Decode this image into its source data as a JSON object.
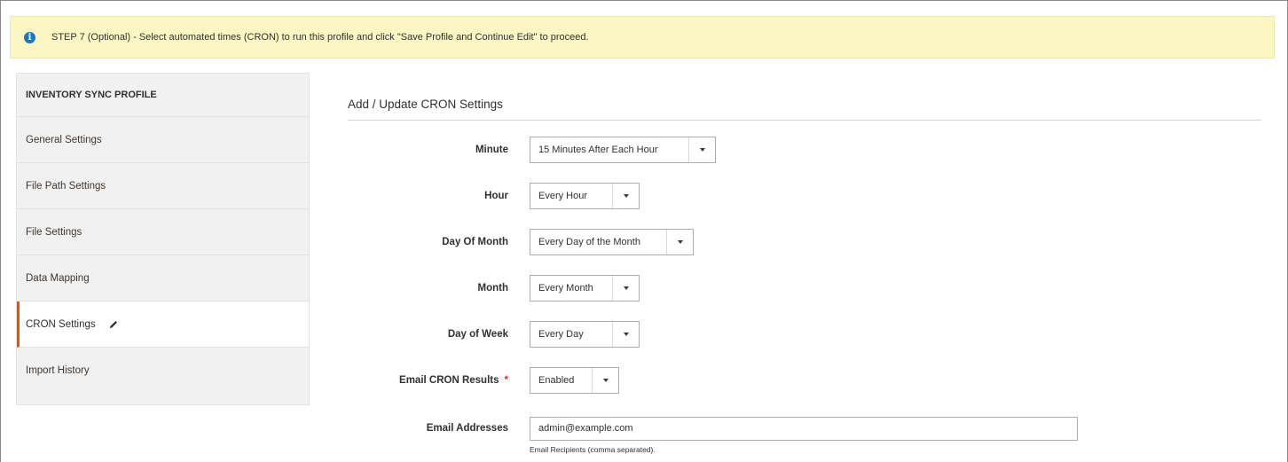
{
  "notice": {
    "icon": "info-icon",
    "text": "STEP 7 (Optional) - Select automated times (CRON) to run this profile and click \"Save Profile and Continue Edit\" to proceed."
  },
  "sidebar": {
    "title": "INVENTORY SYNC PROFILE",
    "items": [
      {
        "label": "General Settings",
        "active": false
      },
      {
        "label": "File Path Settings",
        "active": false
      },
      {
        "label": "File Settings",
        "active": false
      },
      {
        "label": "Data Mapping",
        "active": false
      },
      {
        "label": "CRON Settings",
        "active": true,
        "icon": "pencil-icon"
      },
      {
        "label": "Import History",
        "active": false
      }
    ]
  },
  "section": {
    "title": "Add / Update CRON Settings"
  },
  "form": {
    "minute": {
      "label": "Minute",
      "value": "15 Minutes After Each Hour"
    },
    "hour": {
      "label": "Hour",
      "value": "Every Hour"
    },
    "day_of_month": {
      "label": "Day Of Month",
      "value": "Every Day of the Month"
    },
    "month": {
      "label": "Month",
      "value": "Every Month"
    },
    "day_of_week": {
      "label": "Day of Week",
      "value": "Every Day"
    },
    "email_results": {
      "label": "Email CRON Results",
      "required_mark": "*",
      "value": "Enabled"
    },
    "email_addresses": {
      "label": "Email Addresses",
      "value": "admin@example.com",
      "hint": "Email Recipients (comma separated)."
    }
  },
  "colors": {
    "accent": "#eb5202",
    "notice_bg": "#fbf6c4",
    "info_icon": "#1979c3",
    "required": "#e22626"
  }
}
